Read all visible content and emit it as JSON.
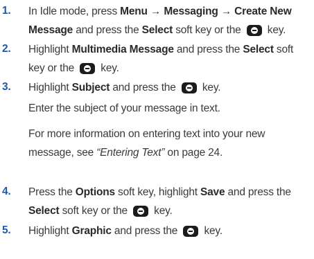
{
  "steps": [
    {
      "number": "1.",
      "line1": {
        "t1": "In Idle mode, press ",
        "b1": "Menu",
        "t2": " → ",
        "b2": "Messaging",
        "t3": " → ",
        "b3": "Create New"
      },
      "line2": {
        "b1": "Message",
        "t1": " and press the ",
        "b2": "Select",
        "t2": " soft key or the ",
        "t3": " key."
      }
    },
    {
      "number": "2.",
      "line1": {
        "t1": "Highlight ",
        "b1": "Multimedia Message",
        "t2": " and press the ",
        "b2": "Select",
        "t3": " soft"
      },
      "line2": {
        "t1": "key or the ",
        "t2": " key."
      }
    },
    {
      "number": "3.",
      "line1": {
        "t1": "Highlight ",
        "b1": "Subject",
        "t2": " and press the ",
        "t3": " key."
      },
      "line2": "Enter the subject of your message in text.",
      "line3": "For more information on entering text into your new",
      "line4": {
        "t1": "message, see ",
        "i1": "“Entering Text”",
        "t2": " on page 24."
      }
    },
    {
      "number": "4.",
      "line1": {
        "t1": "Press the ",
        "b1": "Options",
        "t2": " soft key, highlight ",
        "b2": "Save",
        "t3": " and press the"
      },
      "line2": {
        "b1": "Select",
        "t1": " soft key or the ",
        "t2": " key."
      }
    },
    {
      "number": "5.",
      "line1": {
        "t1": "Highlight ",
        "b1": "Graphic",
        "t2": " and press the ",
        "t3": " key."
      }
    }
  ],
  "icons": {
    "select_key": "center-select-key-icon"
  }
}
